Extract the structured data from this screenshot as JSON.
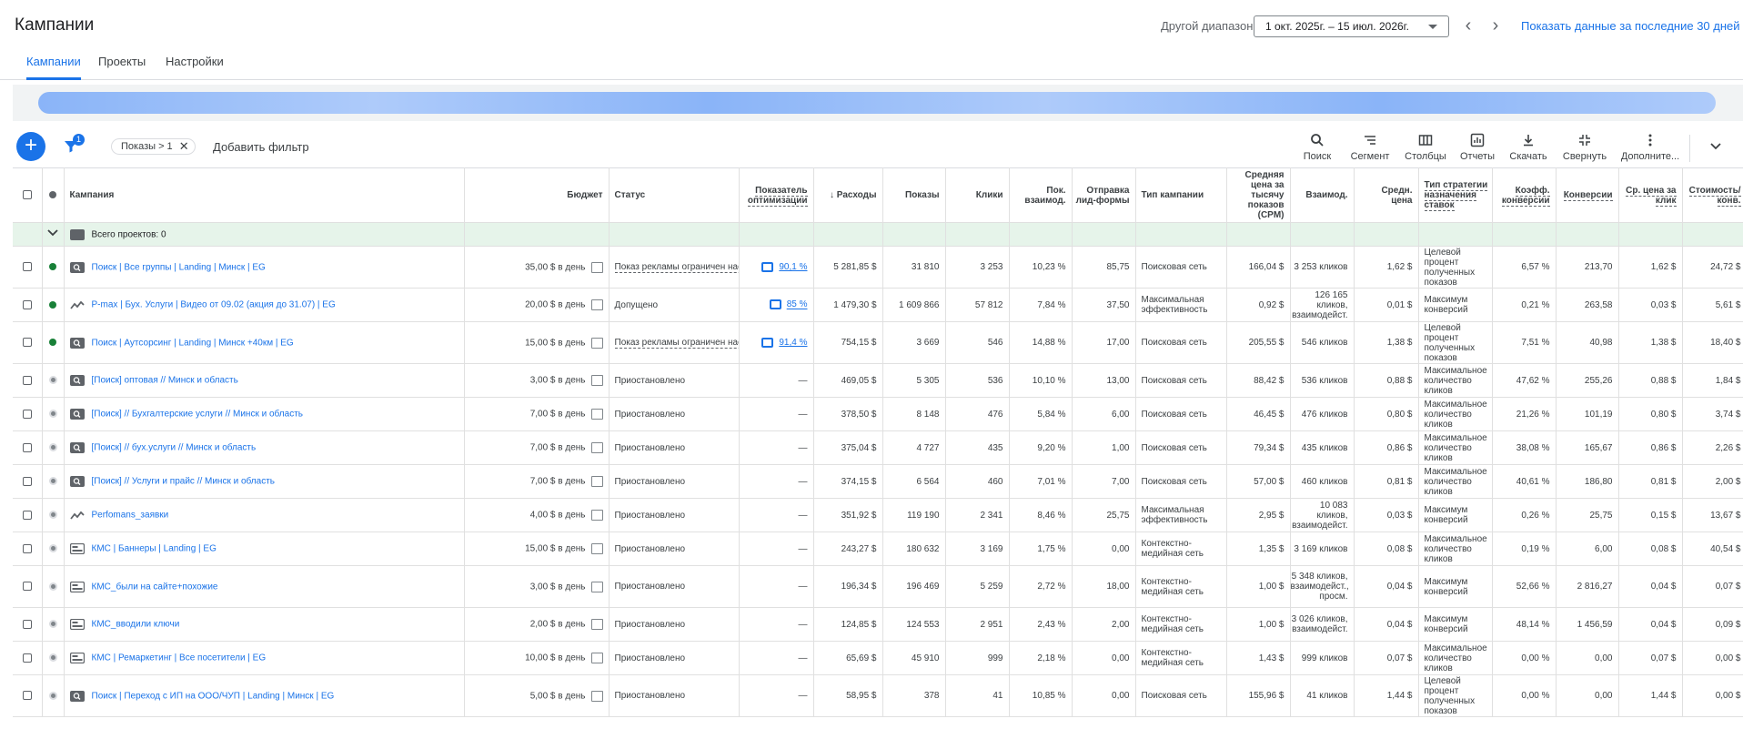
{
  "header": {
    "title": "Кампании",
    "range_label": "Другой диапазон",
    "date_range": "1 окт. 2025г. – 15 июл. 2026г.",
    "last30": "Показать данные за последние 30 дней"
  },
  "tabs": [
    {
      "label": "Кампании"
    },
    {
      "label": "Проекты"
    },
    {
      "label": "Настройки"
    }
  ],
  "toolbar": {
    "filter_count": "1",
    "chip": "Показы > 1",
    "add_filter": "Добавить фильтр",
    "tools": [
      {
        "label": "Поиск",
        "icon": "search-icon"
      },
      {
        "label": "Сегмент",
        "icon": "segment-icon"
      },
      {
        "label": "Столбцы",
        "icon": "columns-icon"
      },
      {
        "label": "Отчеты",
        "icon": "reports-icon"
      },
      {
        "label": "Скачать",
        "icon": "download-icon"
      },
      {
        "label": "Свернуть",
        "icon": "collapse-icon"
      },
      {
        "label": "Дополните...",
        "icon": "more-vert-icon"
      }
    ]
  },
  "table": {
    "headers": {
      "campaign": "Кампания",
      "budget": "Бюджет",
      "status": "Статус",
      "opt": "Показатель оптимизации",
      "cost": "↓ Расходы",
      "impr": "Показы",
      "clicks": "Клики",
      "inter_rate": "Пок. взаимод.",
      "leadform": "Отправка лид-формы",
      "type": "Тип кампании",
      "cpm": "Средняя цена за тысячу показов (CPM)",
      "interactions": "Взаимод.",
      "avg_cost": "Средн. цена",
      "bid_strategy": "Тип стратегии назначения ставок",
      "conv_rate": "Коэфф. конверсии",
      "conv": "Конверсии",
      "avg_cpc": "Ср. цена за клик",
      "cost_conv": "Стоимость/ конв."
    },
    "total_label": "Всего проектов: 0",
    "rows": [
      {
        "status_dot": "green",
        "icon": "search",
        "name": "Поиск | Все группы | Landing | Минск | EG",
        "budget": "35,00 $ в день",
        "status": "Показ рекламы ограничен настройками",
        "status_dashed": true,
        "opt": "90,1 %",
        "cost": "5 281,85 $",
        "impr": "31 810",
        "clicks": "3 253",
        "rate": "10,23 %",
        "lead": "85,75",
        "type": "Поисковая сеть",
        "cpm": "166,04 $",
        "inter": "3 253 кликов",
        "avg": "1,62 $",
        "strat": "Целевой процент полученных показов",
        "cr": "6,57 %",
        "conv": "213,70",
        "cpc": "1,62 $",
        "cpa": "24,72 $",
        "tall": true
      },
      {
        "status_dot": "green",
        "icon": "pmax",
        "name": "P-max | Бух. Услуги | Видео от 09.02 (акция до 31.07) | EG",
        "budget": "20,00 $ в день",
        "status": "Допущено",
        "status_dashed": false,
        "opt": "85 %",
        "cost": "1 479,30 $",
        "impr": "1 609 866",
        "clicks": "57 812",
        "rate": "7,84 %",
        "lead": "37,50",
        "type": "Максимальная эффективность",
        "cpm": "0,92 $",
        "inter": "126 165 кликов, взаимодейст.",
        "avg": "0,01 $",
        "strat": "Максимум конверсий",
        "cr": "0,21 %",
        "conv": "263,58",
        "cpc": "0,03 $",
        "cpa": "5,61 $",
        "tall": false
      },
      {
        "status_dot": "green",
        "icon": "search",
        "name": "Поиск | Аутсорсинг | Landing | Минск +40км | EG",
        "budget": "15,00 $ в день",
        "status": "Показ рекламы ограничен настройками",
        "status_dashed": true,
        "opt": "91,4 %",
        "cost": "754,15 $",
        "impr": "3 669",
        "clicks": "546",
        "rate": "14,88 %",
        "lead": "17,00",
        "type": "Поисковая сеть",
        "cpm": "205,55 $",
        "inter": "546 кликов",
        "avg": "1,38 $",
        "strat": "Целевой процент полученных показов",
        "cr": "7,51 %",
        "conv": "40,98",
        "cpc": "1,38 $",
        "cpa": "18,40 $",
        "tall": true
      },
      {
        "status_dot": "gray",
        "icon": "search",
        "name": "[Поиск] оптовая // Минск и область",
        "budget": "3,00 $ в день",
        "status": "Приостановлено",
        "status_dashed": false,
        "opt": "—",
        "cost": "469,05 $",
        "impr": "5 305",
        "clicks": "536",
        "rate": "10,10 %",
        "lead": "13,00",
        "type": "Поисковая сеть",
        "cpm": "88,42 $",
        "inter": "536 кликов",
        "avg": "0,88 $",
        "strat": "Максимальное количество кликов",
        "cr": "47,62 %",
        "conv": "255,26",
        "cpc": "0,88 $",
        "cpa": "1,84 $",
        "tall": false
      },
      {
        "status_dot": "gray",
        "icon": "search",
        "name": "[Поиск] // Бухгалтерские услуги // Минск и область",
        "budget": "7,00 $ в день",
        "status": "Приостановлено",
        "status_dashed": false,
        "opt": "—",
        "cost": "378,50 $",
        "impr": "8 148",
        "clicks": "476",
        "rate": "5,84 %",
        "lead": "6,00",
        "type": "Поисковая сеть",
        "cpm": "46,45 $",
        "inter": "476 кликов",
        "avg": "0,80 $",
        "strat": "Максимальное количество кликов",
        "cr": "21,26 %",
        "conv": "101,19",
        "cpc": "0,80 $",
        "cpa": "3,74 $",
        "tall": false
      },
      {
        "status_dot": "gray",
        "icon": "search",
        "name": "[Поиск] // бух.услуги // Минск и область",
        "budget": "7,00 $ в день",
        "status": "Приостановлено",
        "status_dashed": false,
        "opt": "—",
        "cost": "375,04 $",
        "impr": "4 727",
        "clicks": "435",
        "rate": "9,20 %",
        "lead": "1,00",
        "type": "Поисковая сеть",
        "cpm": "79,34 $",
        "inter": "435 кликов",
        "avg": "0,86 $",
        "strat": "Максимальное количество кликов",
        "cr": "38,08 %",
        "conv": "165,67",
        "cpc": "0,86 $",
        "cpa": "2,26 $",
        "tall": false
      },
      {
        "status_dot": "gray",
        "icon": "search",
        "name": "[Поиск] // Услуги и прайс // Минск и область",
        "budget": "7,00 $ в день",
        "status": "Приостановлено",
        "status_dashed": false,
        "opt": "—",
        "cost": "374,15 $",
        "impr": "6 564",
        "clicks": "460",
        "rate": "7,01 %",
        "lead": "7,00",
        "type": "Поисковая сеть",
        "cpm": "57,00 $",
        "inter": "460 кликов",
        "avg": "0,81 $",
        "strat": "Максимальное количество кликов",
        "cr": "40,61 %",
        "conv": "186,80",
        "cpc": "0,81 $",
        "cpa": "2,00 $",
        "tall": false
      },
      {
        "status_dot": "gray",
        "icon": "pmax",
        "name": "Perfomans_заявки",
        "budget": "4,00 $ в день",
        "status": "Приостановлено",
        "status_dashed": false,
        "opt": "—",
        "cost": "351,92 $",
        "impr": "119 190",
        "clicks": "2 341",
        "rate": "8,46 %",
        "lead": "25,75",
        "type": "Максимальная эффективность",
        "cpm": "2,95 $",
        "inter": "10 083 кликов, взаимодейст.",
        "avg": "0,03 $",
        "strat": "Максимум конверсий",
        "cr": "0,26 %",
        "conv": "25,75",
        "cpc": "0,15 $",
        "cpa": "13,67 $",
        "tall": false
      },
      {
        "status_dot": "gray",
        "icon": "display",
        "name": "КМС | Баннеры | Landing | EG",
        "budget": "15,00 $ в день",
        "status": "Приостановлено",
        "status_dashed": false,
        "opt": "—",
        "cost": "243,27 $",
        "impr": "180 632",
        "clicks": "3 169",
        "rate": "1,75 %",
        "lead": "0,00",
        "type": "Контекстно-медийная сеть",
        "cpm": "1,35 $",
        "inter": "3 169 кликов",
        "avg": "0,08 $",
        "strat": "Максимальное количество кликов",
        "cr": "0,19 %",
        "conv": "6,00",
        "cpc": "0,08 $",
        "cpa": "40,54 $",
        "tall": false
      },
      {
        "status_dot": "gray",
        "icon": "display",
        "name": "КМС_были на сайте+похожие",
        "budget": "3,00 $ в день",
        "status": "Приостановлено",
        "status_dashed": false,
        "opt": "—",
        "cost": "196,34 $",
        "impr": "196 469",
        "clicks": "5 259",
        "rate": "2,72 %",
        "lead": "18,00",
        "type": "Контекстно-медийная сеть",
        "cpm": "1,00 $",
        "inter": "5 348 кликов, взаимодейст., просм.",
        "avg": "0,04 $",
        "strat": "Максимум конверсий",
        "cr": "52,66 %",
        "conv": "2 816,27",
        "cpc": "0,04 $",
        "cpa": "0,07 $",
        "tall": true
      },
      {
        "status_dot": "gray",
        "icon": "display",
        "name": "КМС_вводили ключи",
        "budget": "2,00 $ в день",
        "status": "Приостановлено",
        "status_dashed": false,
        "opt": "—",
        "cost": "124,85 $",
        "impr": "124 553",
        "clicks": "2 951",
        "rate": "2,43 %",
        "lead": "2,00",
        "type": "Контекстно-медийная сеть",
        "cpm": "1,00 $",
        "inter": "3 026 кликов, взаимодейст.",
        "avg": "0,04 $",
        "strat": "Максимум конверсий",
        "cr": "48,14 %",
        "conv": "1 456,59",
        "cpc": "0,04 $",
        "cpa": "0,09 $",
        "tall": false
      },
      {
        "status_dot": "gray",
        "icon": "display",
        "name": "КМС | Ремаркетинг | Все посетители | EG",
        "budget": "10,00 $ в день",
        "status": "Приостановлено",
        "status_dashed": false,
        "opt": "—",
        "cost": "65,69 $",
        "impr": "45 910",
        "clicks": "999",
        "rate": "2,18 %",
        "lead": "0,00",
        "type": "Контекстно-медийная сеть",
        "cpm": "1,43 $",
        "inter": "999 кликов",
        "avg": "0,07 $",
        "strat": "Максимальное количество кликов",
        "cr": "0,00 %",
        "conv": "0,00",
        "cpc": "0,07 $",
        "cpa": "0,00 $",
        "tall": false
      },
      {
        "status_dot": "gray",
        "icon": "search",
        "name": "Поиск | Переход с ИП на ООО/ЧУП | Landing | Минск | EG",
        "budget": "5,00 $ в день",
        "status": "Приостановлено",
        "status_dashed": false,
        "opt": "—",
        "cost": "58,95 $",
        "impr": "378",
        "clicks": "41",
        "rate": "10,85 %",
        "lead": "0,00",
        "type": "Поисковая сеть",
        "cpm": "155,96 $",
        "inter": "41 кликов",
        "avg": "1,44 $",
        "strat": "Целевой процент полученных показов",
        "cr": "0,00 %",
        "conv": "0,00",
        "cpc": "1,44 $",
        "cpa": "0,00 $",
        "tall": true
      }
    ]
  },
  "colors": {
    "accent": "#1a73e8",
    "enabled": "#188038",
    "paused": "#80868b",
    "total_row": "#e6f4ea"
  }
}
